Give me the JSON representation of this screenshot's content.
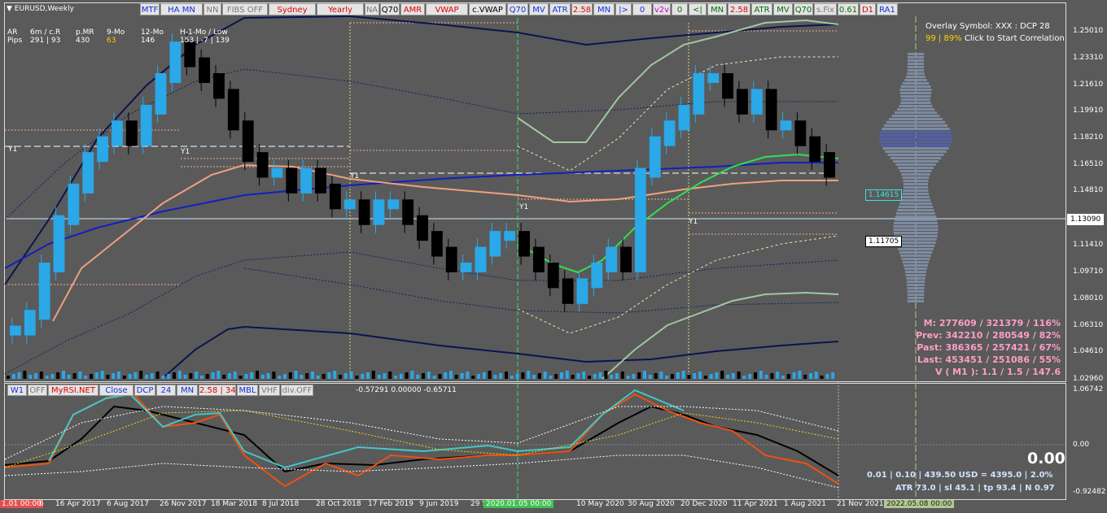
{
  "symbol_title": "EURUSD,Weekly",
  "toolbar": [
    {
      "label": "MTF",
      "color": "#1030e0"
    },
    {
      "label": "HA MN",
      "color": "#1030e0"
    },
    {
      "label": "NN",
      "color": "#777"
    },
    {
      "label": "FIBS OFF",
      "color": "#777"
    },
    {
      "label": "Sydney",
      "color": "#e00000"
    },
    {
      "label": "Yearly",
      "color": "#e00000"
    },
    {
      "label": "NA",
      "color": "#777"
    },
    {
      "label": "Q70",
      "color": "#000"
    },
    {
      "label": "AMR",
      "color": "#e00000"
    },
    {
      "label": "VWAP",
      "color": "#e00000"
    },
    {
      "label": "c.VWAP",
      "color": "#000"
    },
    {
      "label": "Q70",
      "color": "#1030e0"
    },
    {
      "label": "MV",
      "color": "#1030e0"
    },
    {
      "label": "ATR",
      "color": "#1030e0"
    },
    {
      "label": "2.58",
      "color": "#e00000"
    },
    {
      "label": "MN",
      "color": "#1030e0"
    },
    {
      "label": "|>",
      "color": "#1030e0"
    },
    {
      "label": "0",
      "color": "#1030e0"
    },
    {
      "label": "v2v",
      "color": "#c000c0"
    },
    {
      "label": "0",
      "color": "#007000"
    },
    {
      "label": "<|",
      "color": "#007000"
    },
    {
      "label": "MN",
      "color": "#007000"
    },
    {
      "label": "2.58",
      "color": "#e00000"
    },
    {
      "label": "ATR",
      "color": "#007000"
    },
    {
      "label": "MV",
      "color": "#007000"
    },
    {
      "label": "Q70",
      "color": "#007000"
    },
    {
      "label": "s.Fix",
      "color": "#777"
    },
    {
      "label": "0.61",
      "color": "#007000"
    },
    {
      "label": "D1",
      "color": "#e00000"
    },
    {
      "label": "RA1",
      "color": "#1030e0"
    }
  ],
  "stats_header": {
    "row1": [
      "AR",
      "6m / c.R",
      "p.MR",
      "9-Mo",
      "12-Mo",
      "H-1-Mo / Low"
    ],
    "row2": [
      "Pips",
      "291 | 93",
      "430",
      "63",
      "146",
      "153 | -7 | 139"
    ]
  },
  "overlay": {
    "line1": "Overlay Symbol: XXX : DCP 28",
    "line2_prefix": "99 | 89%",
    "line2_suffix": " Click to Start Correlation"
  },
  "price_axis": [
    "1.25010",
    "1.23310",
    "1.21610",
    "1.19910",
    "1.18210",
    "1.16510",
    "1.14810",
    "1.13090",
    "1.11410",
    "1.09710",
    "1.08010",
    "1.06310",
    "1.04610",
    "1.02960"
  ],
  "price_boxes": {
    "upper": "1.14615",
    "current": "1.13090",
    "lower": "1.11705"
  },
  "volume_stats": [
    "M: 277609 / 321379 / 116%",
    "Prev: 342210 / 280549 / 82%",
    "Past: 386365 / 257421 / 67%",
    "Last: 453451 / 251086 / 55%",
    "V ( M1 ): 1.1 / 1.5 / 147.6"
  ],
  "y_labels": [
    "Y1",
    "Y1",
    "Y1",
    "Y1",
    "Y1"
  ],
  "sub_toolbar": [
    {
      "label": "W1",
      "color": "#1030e0"
    },
    {
      "label": "OFF",
      "color": "#777"
    },
    {
      "label": "MyRSI.NET",
      "color": "#e00000"
    },
    {
      "label": "Close",
      "color": "#1030e0"
    },
    {
      "label": "DCP",
      "color": "#1030e0"
    },
    {
      "label": "24",
      "color": "#1030e0"
    },
    {
      "label": "MN",
      "color": "#1030e0"
    },
    {
      "label": "2.58 | 34",
      "color": "#e00000"
    },
    {
      "label": "MBL",
      "color": "#1030e0"
    },
    {
      "label": "VHF",
      "color": "#777"
    },
    {
      "label": "div.OFF",
      "color": "#777"
    }
  ],
  "sub_values": "-0.57291 0.00000 -0.65711",
  "sub_axis": [
    "1.06742",
    "0.00",
    "-0.92482"
  ],
  "sub_big_value": "0.00",
  "sub_info1": "0.01  |  0.10  |  439.50 USD = 4395.0  |  2.0%",
  "sub_info2": "ATR 73.0  |  sl 45.1  |  tp 93.4  |  N 0.97",
  "time_axis": [
    "16 Apr 2017",
    "6 Aug 2017",
    "26 Nov 2017",
    "18 Mar 2018",
    "8 Jul 2018",
    "28 Oct 2018",
    "17 Feb 2019",
    "9 Jun 2019",
    "29 S",
    "20",
    "10 May 2020",
    "30 Aug 2020",
    "20 Dec 2020",
    "11 Apr 2021",
    "1 Aug 2021",
    "21 Nov 2021"
  ],
  "time_left_label": "1.01 00:00",
  "time_left_suffix": "6",
  "time_cursor_label": "2020.01.05 00:00",
  "time_right_label": "2022.05.08 00:00",
  "colors": {
    "background": "#5a5a5a",
    "bull": "#2aa8e8",
    "bear": "#000000",
    "ma_fast": "#f0a080",
    "ma_slow": "#1020c0",
    "ma_green": "#30e050",
    "band": "#a0c8a0",
    "band_dark": "#0a1450",
    "rsi_fast": "#f05010",
    "rsi_slow": "#40c8c8",
    "cursor": "#40e060",
    "stat_pink": "#ff9ec6"
  }
}
